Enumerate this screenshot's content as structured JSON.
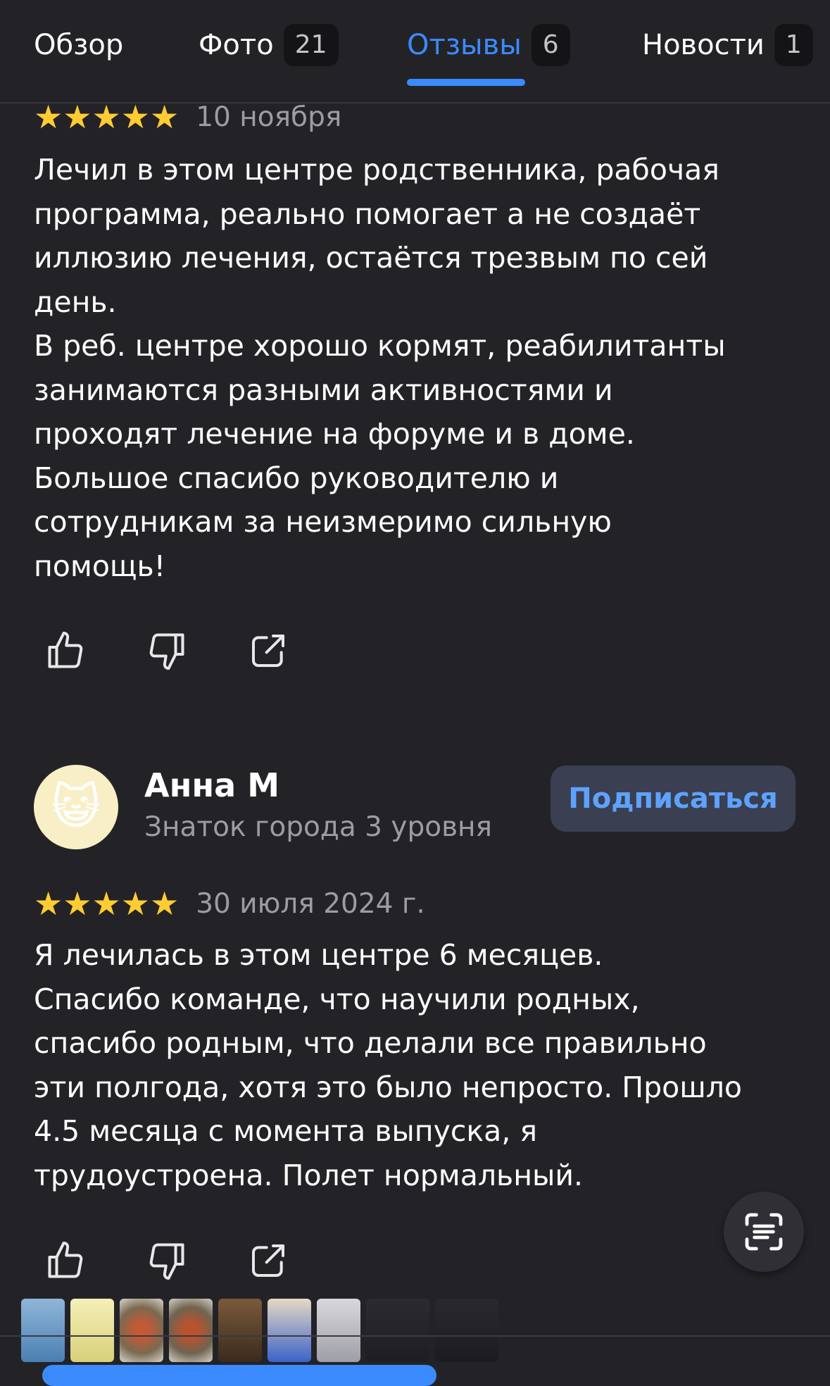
{
  "tabs": [
    {
      "label": "Обзор",
      "badge": ""
    },
    {
      "label": "Фото",
      "badge": "21"
    },
    {
      "label": "Отзывы",
      "badge": "6"
    },
    {
      "label": "Новости",
      "badge": "1"
    }
  ],
  "active_tab": "Отзывы",
  "review1": {
    "rating": 5,
    "stars": "★★★★★",
    "date": "10 ноября",
    "text": "Лечил в этом центре родственника, рабочая\nпрограмма, реально помогает а не создаёт\nиллюзию лечения, остаётся трезвым по сей\nдень.\nВ реб. центре хорошо кормят, реабилитанты\nзанимаются разными активностями и\nпроходят лечение на форуме и в доме.\nБольшое спасибо руководителю и\nсотрудникам за неизмеримо сильную\nпомощь!"
  },
  "review2": {
    "author": {
      "avatar": "😺",
      "name": "Анна М",
      "level": "Знаток города 3 уровня",
      "subscribe_label": "Подписаться"
    },
    "rating": 5,
    "stars": "★★★★★",
    "date": "30 июля 2024 г.",
    "text": "Я лечилась в этом центре 6 месяцев.\nСпасибо команде, что научили родных,\nспасибо родным, что делали все правильно\nэти полгода, хотя это было непросто. Прошло\n4.5 месяца с момента выпуска, я\nтрудоустроена. Полет нормальный."
  },
  "icons": {
    "like": "thumb-up-icon",
    "dislike": "thumb-down-icon",
    "share": "share-icon",
    "scan": "text-scan-icon"
  },
  "colors": {
    "background": "#232327",
    "accent": "#3b8bff",
    "star": "#ffcc33",
    "muted": "#9c9ca2"
  }
}
